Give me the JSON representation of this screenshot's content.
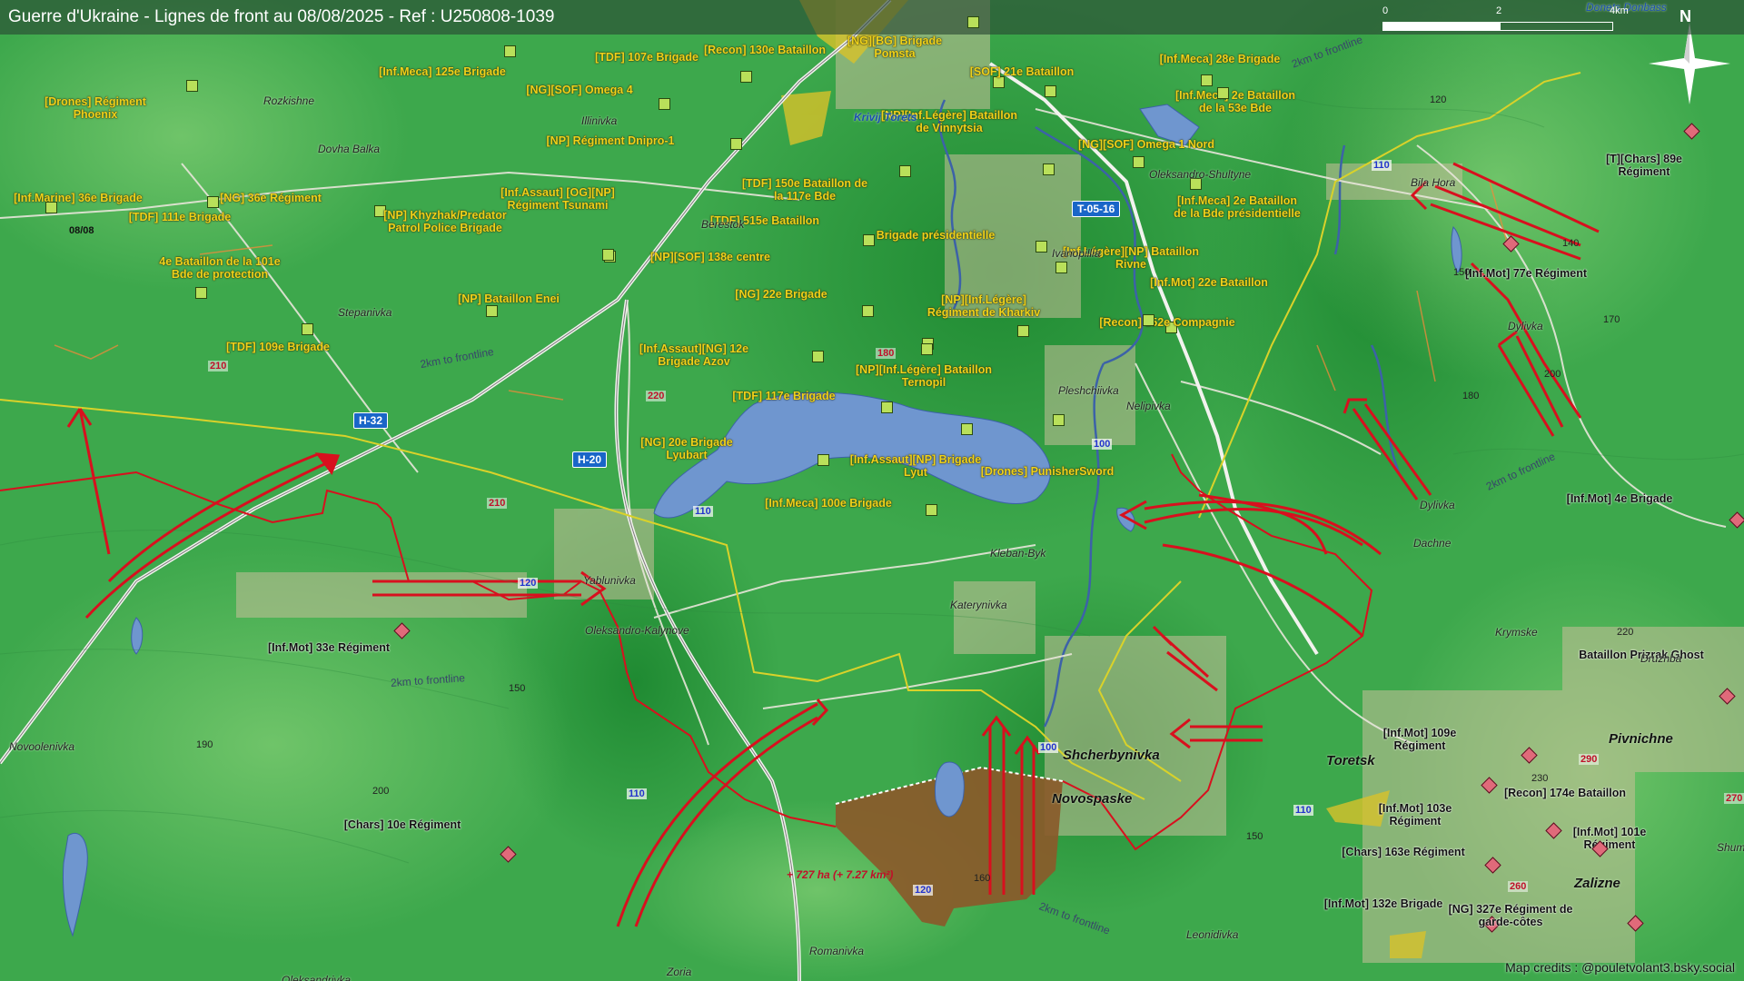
{
  "header": {
    "title": "Guerre d'Ukraine - Lignes de front au 08/08/2025 - Ref : U250808-1039",
    "scale_labels": [
      "0",
      "2",
      "4km"
    ],
    "north_label": "N",
    "corner_place": "Donets Donbass"
  },
  "colors": {
    "front_arrows": "#d8101e",
    "ukrainian_units": "#b9e05a",
    "russian_units": "#e06a7a",
    "captured_area": "#8a5a2a",
    "unit_text": "#f0d21a",
    "water": "#6f96cf"
  },
  "units_ukraine": [
    {
      "label": "[Drones] Régiment Phoenix"
    },
    {
      "label": "[Inf.Meca] 125e Brigade"
    },
    {
      "label": "[TDF] 107e Brigade"
    },
    {
      "label": "[Recon] 130e Bataillon"
    },
    {
      "label": "[NG][BG] Brigade Pomsta"
    },
    {
      "label": "[SOF] 21e Bataillon"
    },
    {
      "label": "[Inf.Meca] 28e Brigade"
    },
    {
      "label": "[NG][SOF] Omega 4"
    },
    {
      "label": "[Inf.Meca] 2e Bataillon de la 53e Bde"
    },
    {
      "label": "[NP][Inf.Légère] Bataillon de Vinnytsia"
    },
    {
      "label": "[NP] Régiment Dnipro-1"
    },
    {
      "label": "[NG][SOF] Omega 1 Nord"
    },
    {
      "label": "[Inf.Marine] 36e Brigade"
    },
    {
      "label": "[NG] 36e Régiment"
    },
    {
      "label": "[TDF] 111e Brigade"
    },
    {
      "label": "[Inf.Assaut] [OG][NP] Régiment Tsunami"
    },
    {
      "label": "[TDF] 150e Bataillon de la 117e Bde"
    },
    {
      "label": "[Inf.Meca] 2e Bataillon de la Bde présidentielle"
    },
    {
      "label": "[NP] Khyzhak/Predator Patrol Police Brigade"
    },
    {
      "label": "[TDF] 515e Bataillon"
    },
    {
      "label": "Brigade présidentielle"
    },
    {
      "label": "4e Bataillon de la 101e Bde de protection"
    },
    {
      "label": "[NP][SOF] 138e centre"
    },
    {
      "label": "[Inf.Légère][NP] Bataillon Rivne"
    },
    {
      "label": "[NG] 22e Brigade"
    },
    {
      "label": "[Inf.Mot] 22e Bataillon"
    },
    {
      "label": "[NP] Bataillon Enei"
    },
    {
      "label": "[NP][Inf.Légère] Régiment de Kharkiv"
    },
    {
      "label": "[TDF] 109e Brigade"
    },
    {
      "label": "[Recon] 152e Compagnie"
    },
    {
      "label": "[Inf.Assaut][NG] 12e Brigade Azov"
    },
    {
      "label": "[NP][Inf.Légère] Bataillon Ternopil"
    },
    {
      "label": "[TDF] 117e Brigade"
    },
    {
      "label": "[NG] 20e Brigade Lyubart"
    },
    {
      "label": "[Inf.Assaut][NP] Brigade Lyut"
    },
    {
      "label": "[Drones] PunisherSword"
    },
    {
      "label": "[Inf.Meca] 100e Brigade"
    }
  ],
  "units_russia": [
    {
      "label": "[T][Chars] 89e Régiment"
    },
    {
      "label": "[Inf.Mot] 77e Régiment"
    },
    {
      "label": "[Inf.Mot] 4e Brigade"
    },
    {
      "label": "[Inf.Mot] 33e Régiment"
    },
    {
      "label": "Bataillon Prizrak Ghost"
    },
    {
      "label": "[Inf.Mot] 109e Régiment"
    },
    {
      "label": "[Chars] 10e Régiment"
    },
    {
      "label": "[Inf.Mot] 103e Régiment"
    },
    {
      "label": "[Recon] 174e Bataillon"
    },
    {
      "label": "[Inf.Mot] 101e Régiment"
    },
    {
      "label": "[Chars] 163e Régiment"
    },
    {
      "label": "[Inf.Mot] 132e Brigade"
    },
    {
      "label": "[NG] 327e Régiment de garde-côtes"
    }
  ],
  "places": [
    "Rozkishne",
    "Dovha Balka",
    "Illinivka",
    "Berestok",
    "Krivij Torets",
    "Oleksandro-Shultyne",
    "Bila Hora",
    "Ivanopillia",
    "Stepanivka",
    "Pleshchiivka",
    "Nelipivka",
    "Dylivka",
    "Dylivka",
    "Dachne",
    "Kleban-Byk",
    "Yablunivka",
    "Katerynivka",
    "Oleksandro-Kalynove",
    "Krymske",
    "Druzhba",
    "Novoolenivka",
    "Shcherbynivka",
    "Novospaske",
    "Toretsk",
    "Pivnichne",
    "Zalizne",
    "Romanivka",
    "Leonidivka",
    "Zoria",
    "Oleksandrivka",
    "Shum"
  ],
  "elevations": [
    "120",
    "140",
    "150",
    "160",
    "170",
    "180",
    "190",
    "200",
    "210",
    "220",
    "230",
    "270"
  ],
  "red_elevations": [
    "210",
    "220",
    "180",
    "210",
    "290",
    "260",
    "270"
  ],
  "roads": {
    "shields": [
      "H-32",
      "H-20",
      "T-05-16"
    ],
    "numbers": [
      "110",
      "110",
      "120",
      "100",
      "100",
      "110",
      "120",
      "110"
    ]
  },
  "front_labels": [
    "2km to frontline",
    "2km to frontline",
    "2km to frontline",
    "2km to frontline",
    "2km to frontline"
  ],
  "date_marker": "08/08",
  "area_gain": "+ 727 ha (+ 7.27 km²)",
  "credits": "Map credits : @pouletvolant3.bsky.social"
}
